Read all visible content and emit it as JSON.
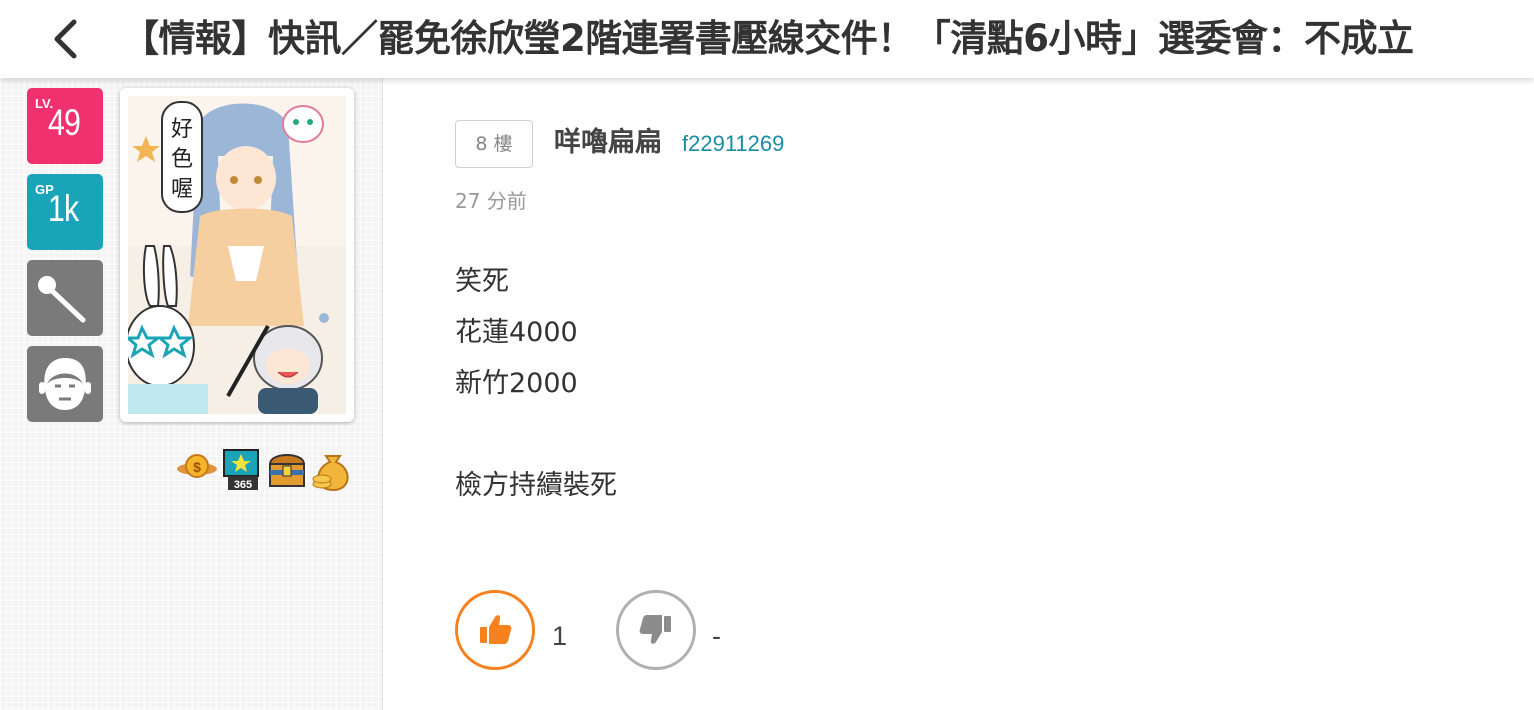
{
  "header": {
    "title": "【情報】快訊／罷免徐欣瑩2階連署書壓線交件！「清點6小時」選委會：不成立",
    "back_icon": "chevron-left-icon"
  },
  "user_panel": {
    "level": {
      "prefix": "LV.",
      "value": "49",
      "color": "#f0306f"
    },
    "gp": {
      "prefix": "GP",
      "value": "1k",
      "color": "#1aa4b8"
    },
    "tool_icon": "magic-wand-icon",
    "face_icon": "face-icon",
    "avatar_text": "好色喔",
    "medals": [
      "coin-medal-icon",
      "365-medal-icon",
      "treasure-chest-icon",
      "money-bag-icon"
    ]
  },
  "post": {
    "floor": "8 樓",
    "username": "咩嚕扁扁",
    "user_id": "f22911269",
    "time": "27 分前",
    "lines": [
      "笑死",
      "花蓮4000",
      "新竹2000",
      "",
      "檢方持續裝死"
    ],
    "likes": "1",
    "dislikes": "-",
    "accent_color": "#f5821f"
  }
}
